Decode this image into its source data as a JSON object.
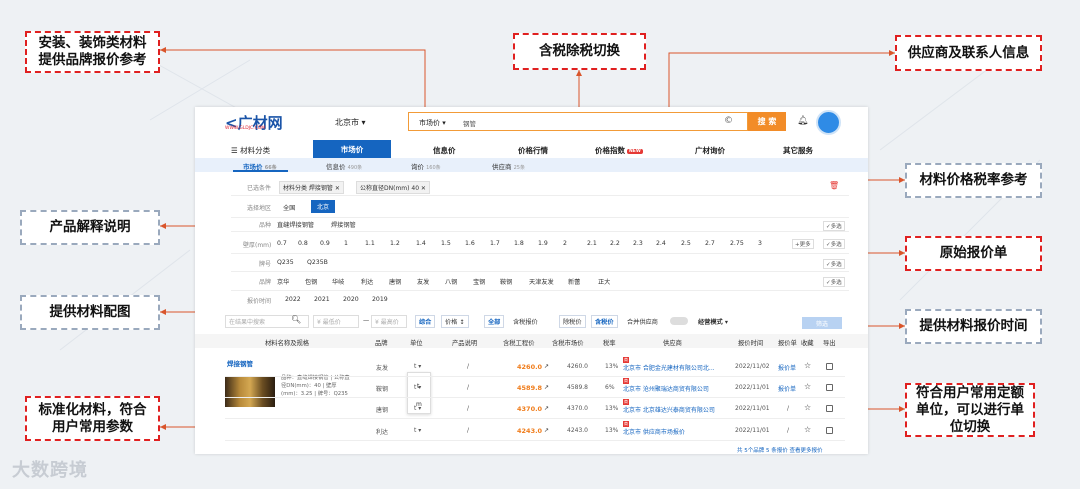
{
  "watermark": "大数跨境",
  "callouts": {
    "install_materials": "安装、装饰类材料\n提供品牌报价参考",
    "tax_toggle": "含税除税切换",
    "supplier_info": "供应商及联系人信息",
    "tax_rate": "材料价格税率参考",
    "product_explain": "产品解释说明",
    "original_quote": "原始报价单",
    "material_image": "提供材料配图",
    "quote_time": "提供材料报价时间",
    "standard_params": "标准化材料，符合\n用户常用参数",
    "unit_switch": "符合用户常用定额\n单位，可以进行单\n位切换"
  },
  "header": {
    "logo": "广材网",
    "logo_sub": "WWW.GLDJC.COM",
    "city": "北京市 ▾",
    "search_type": "市场价 ▾",
    "search_value": "钢管",
    "search_button": "搜 索"
  },
  "nav": {
    "category": "材料分类",
    "items": [
      "市场价",
      "信息价",
      "价格行情",
      "价格指数",
      "广材询价",
      "其它服务"
    ],
    "new_badge": "NEW"
  },
  "subtabs": [
    {
      "label": "市场价",
      "count": "66条"
    },
    {
      "label": "信息价",
      "count": "490条"
    },
    {
      "label": "询价",
      "count": "160条"
    },
    {
      "label": "供应商",
      "count": "25条"
    }
  ],
  "filters": {
    "selected_label": "已选条件",
    "selected": [
      "材料分类  焊接钢管  ✕",
      "公称直径DN(mm)  40  ✕"
    ],
    "region_label": "选择地区",
    "regions": [
      "全国",
      "北京"
    ],
    "name_label": "品种",
    "names": [
      "直缝焊接钢管",
      "焊接钢管"
    ],
    "spec_label": "壁厚(mm)",
    "specs": [
      "0.7",
      "0.8",
      "0.9",
      "1",
      "1.1",
      "1.2",
      "1.4",
      "1.5",
      "1.6",
      "1.7",
      "1.8",
      "1.9",
      "2",
      "2.1",
      "2.2",
      "2.3",
      "2.4",
      "2.5",
      "2.7",
      "2.75",
      "3"
    ],
    "more": "+更多",
    "multi": "✓多选",
    "grade_label": "牌号",
    "grades": [
      "Q235",
      "Q235B"
    ],
    "brand_label": "品牌",
    "brands": [
      "京华",
      "包钢",
      "华岐",
      "利达",
      "唐钢",
      "友发",
      "八钢",
      "宝钢",
      "鞍钢",
      "天津友发",
      "新蕾",
      "正大"
    ],
    "time_label": "报价时间",
    "times": [
      "2022",
      "2021",
      "2020",
      "2019"
    ]
  },
  "toolbar": {
    "search_placeholder": "在结果中搜索",
    "min_price": "¥ 最低价",
    "dash": "—",
    "max_price": "¥ 最高价",
    "sort_all": "综合",
    "sort_price": "价格 ↕",
    "all": "全部",
    "with_tax": "含税报价",
    "ex_tax": "除税价",
    "incl_tax": "含税价",
    "merge_supplier": "合并供应商",
    "mode": "经营模式 ▾",
    "filter_btn": "筛选"
  },
  "table": {
    "headers": [
      "材料名称及规格",
      "品牌",
      "单位",
      "产品说明",
      "含税工程价",
      "含税市场价",
      "税率",
      "供应商",
      "报价时间",
      "报价单",
      "收藏",
      "导出"
    ],
    "product_name": "焊接钢管",
    "product_desc": "品种：直缝焊接钢管 | 公称直径DN(mm)：40 | 壁厚(mm)：3.25 | 牌号：Q235",
    "unit_options": [
      "t",
      "m"
    ],
    "rows": [
      {
        "brand": "友发",
        "unit": "t ▾",
        "desc": "/",
        "eng_price": "4260.0",
        "mkt_price": "4260.0",
        "tax": "13%",
        "supplier": "北京市 合肥金光建材有限公司北...",
        "date": "2022/11/02",
        "quote": "报价单"
      },
      {
        "brand": "鞍钢",
        "unit": "t ▾",
        "desc": "/",
        "eng_price": "4589.8",
        "mkt_price": "4589.8",
        "tax": "6%",
        "supplier": "北京市 沧州聚瑞达商贸有限公司",
        "date": "2022/11/01",
        "quote": "报价单"
      },
      {
        "brand": "唐钢",
        "unit": "t ▾",
        "desc": "/",
        "eng_price": "4370.0",
        "mkt_price": "4370.0",
        "tax": "13%",
        "supplier": "北京市 北京雄达兴泰商贸有限公司",
        "date": "2022/11/01",
        "quote": "/"
      },
      {
        "brand": "利达",
        "unit": "t ▾",
        "desc": "/",
        "eng_price": "4243.0",
        "mkt_price": "4243.0",
        "tax": "13%",
        "supplier": "北京市 供应商市场报价",
        "date": "2022/11/01",
        "quote": "/"
      }
    ],
    "footer": "共 5个品牌 5 条报价  查看更多报价"
  }
}
